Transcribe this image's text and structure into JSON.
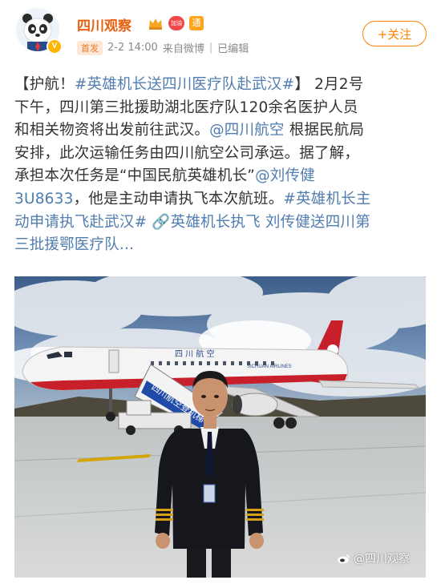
{
  "post": {
    "username": "四川观察",
    "badge_heart_text": "加油",
    "badge_wen_text": "通",
    "pill": "首发",
    "time": "2-2 14:00",
    "source": "来自微博",
    "edited": "已编辑",
    "follow_label": "+关注",
    "text": {
      "l1_a": "【护航！",
      "l1_link": "#英雄机长送四川医疗队赴武汉#",
      "l1_b": "】 2月2号",
      "l2": "下午，四川第三批援助湖北医疗队120余名医护人员",
      "l3_a": "和相关物资将出发前往武汉。",
      "l3_link": "@四川航空",
      "l3_b": " 根据民航局",
      "l4": "安排，此次运输任务由四川航空公司承运。据了解，",
      "l5_a": "承担本次任务是“中国民航英雄机长”",
      "l5_link": "@刘传健",
      "l6_link": "3U8633",
      "l6_b": "，他是主动申请执飞本次航班。",
      "l6_link2": "#英雄机长主",
      "l7_link": "动申请执飞赴武汉#",
      "l7_link2": " 🔗英雄机长执飞 刘传健送四川第",
      "l8_link": "三批援鄂医疗队..."
    }
  },
  "photo": {
    "fuselage_text": "四 川 航 空",
    "airline_text": "SICHUAN AIRLINES",
    "stair_text": "四川航空登机梯",
    "watermark": "@四川观察"
  },
  "colors": {
    "username": "#e8600f",
    "link": "#507daf",
    "follow": "#ff8200",
    "airline_red": "#c8202b"
  }
}
